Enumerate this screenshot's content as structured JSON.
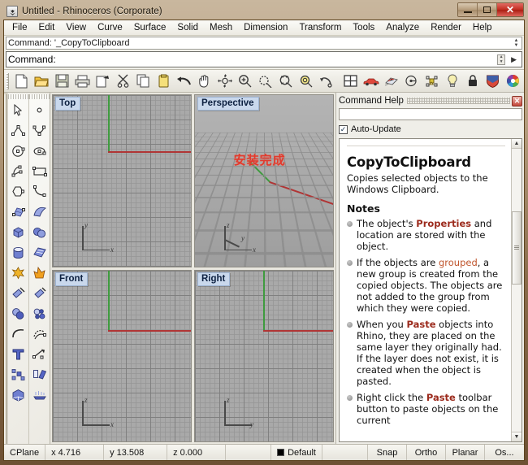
{
  "window": {
    "title": "Untitled - Rhinoceros (Corporate)",
    "app_icon": "rhinoceros-icon",
    "controls": [
      {
        "name": "minimize-button",
        "glyph": "minimize-icon"
      },
      {
        "name": "maximize-button",
        "glyph": "maximize-icon"
      },
      {
        "name": "close-button",
        "glyph": "close-icon",
        "label": "✕"
      }
    ]
  },
  "menubar": {
    "items": [
      {
        "label": "File"
      },
      {
        "label": "Edit"
      },
      {
        "label": "View"
      },
      {
        "label": "Curve"
      },
      {
        "label": "Surface"
      },
      {
        "label": "Solid"
      },
      {
        "label": "Mesh"
      },
      {
        "label": "Dimension"
      },
      {
        "label": "Transform"
      },
      {
        "label": "Tools"
      },
      {
        "label": "Analyze"
      },
      {
        "label": "Render"
      },
      {
        "label": "Help"
      }
    ]
  },
  "command_area": {
    "history_line": "Command: '_CopyToClipboard",
    "prompt_label": "Command:",
    "input_value": "",
    "input_placeholder": ""
  },
  "toolbar": {
    "buttons": [
      {
        "name": "new-file-icon",
        "title": "New"
      },
      {
        "name": "open-file-icon",
        "title": "Open"
      },
      {
        "name": "save-file-icon",
        "title": "Save"
      },
      {
        "name": "print-icon",
        "title": "Print"
      },
      {
        "name": "copy-to-clipboard-icon",
        "title": "Copy to Clipboard"
      },
      {
        "name": "cut-icon",
        "title": "Cut"
      },
      {
        "name": "copy-icon",
        "title": "Copy"
      },
      {
        "name": "paste-icon",
        "title": "Paste"
      },
      {
        "name": "undo-icon",
        "title": "Undo"
      },
      {
        "name": "pan-hand-icon",
        "title": "Pan"
      },
      {
        "name": "rotate-view-icon",
        "title": "Rotate View"
      },
      {
        "name": "zoom-in-icon",
        "title": "Zoom In"
      },
      {
        "name": "zoom-dynamic-icon",
        "title": "Zoom Dynamic"
      },
      {
        "name": "zoom-window-icon",
        "title": "Zoom Window"
      },
      {
        "name": "zoom-extents-icon",
        "title": "Zoom Extents"
      },
      {
        "name": "zoom-previous-icon",
        "title": "Zoom Previous"
      },
      {
        "name": "four-viewport-icon",
        "title": "4 Viewports"
      },
      {
        "name": "render-car-icon",
        "title": "Render"
      },
      {
        "name": "render-preview-icon",
        "title": "Render Preview"
      },
      {
        "name": "shade-icon",
        "title": "Shade"
      },
      {
        "name": "properties-icon",
        "title": "Properties"
      },
      {
        "name": "light-bulb-icon",
        "title": "Lights"
      },
      {
        "name": "lock-icon",
        "title": "Lock"
      },
      {
        "name": "layer-shield-icon",
        "title": "Layers"
      },
      {
        "name": "color-wheel-icon",
        "title": "Color"
      }
    ]
  },
  "left_toolbar": {
    "column_a": [
      {
        "name": "select-arrow-icon"
      },
      {
        "name": "polyline-icon"
      },
      {
        "name": "circle-icon"
      },
      {
        "name": "arc-icon"
      },
      {
        "name": "polygon-icon"
      },
      {
        "name": "surface-from-points-icon"
      },
      {
        "name": "box-icon"
      },
      {
        "name": "cylinder-icon"
      },
      {
        "name": "explode-star-icon"
      },
      {
        "name": "trim-icon"
      },
      {
        "name": "boolean-union-icon"
      },
      {
        "name": "fillet-curve-icon"
      },
      {
        "name": "text-tool-icon"
      },
      {
        "name": "array-icon"
      },
      {
        "name": "extrude-solid-icon"
      }
    ],
    "column_b": [
      {
        "name": "point-icon"
      },
      {
        "name": "control-point-curve-icon"
      },
      {
        "name": "ellipse-icon"
      },
      {
        "name": "rectangle-icon"
      },
      {
        "name": "curve-interpolate-icon"
      },
      {
        "name": "surface-sweep-icon"
      },
      {
        "name": "sphere-icon"
      },
      {
        "name": "surface-plane-icon"
      },
      {
        "name": "explode-flame-icon"
      },
      {
        "name": "split-icon"
      },
      {
        "name": "boolean-difference-icon"
      },
      {
        "name": "offset-curve-icon"
      },
      {
        "name": "dimension-icon"
      },
      {
        "name": "move-icon"
      },
      {
        "name": "sweep-rail-icon"
      }
    ]
  },
  "viewports": [
    {
      "name": "viewport-top",
      "label": "Top",
      "axes": [
        "y",
        "x"
      ]
    },
    {
      "name": "viewport-perspective",
      "label": "Perspective",
      "axes": [
        "z",
        "y",
        "x"
      ],
      "overlay_text": "安装完成"
    },
    {
      "name": "viewport-front",
      "label": "Front",
      "axes": [
        "z",
        "x"
      ]
    },
    {
      "name": "viewport-right",
      "label": "Right",
      "axes": [
        "z",
        "y"
      ]
    }
  ],
  "help_panel": {
    "title": "Command Help",
    "close_label": "✕",
    "search_value": "",
    "auto_update_label": "Auto-Update",
    "auto_update_checked": true,
    "check_glyph": "✓",
    "heading": "CopyToClipboard",
    "description": "Copies selected objects to the Windows Clipboard.",
    "notes_heading": "Notes",
    "notes": [
      {
        "parts": [
          {
            "t": "The object's "
          },
          {
            "t": "Properties",
            "style": "strong"
          },
          {
            "t": " and location are stored with the object."
          }
        ]
      },
      {
        "parts": [
          {
            "t": "If the objects are "
          },
          {
            "t": "grouped",
            "style": "link"
          },
          {
            "t": ", a new group is created from the copied objects. The objects are not added to the group from which they were copied."
          }
        ]
      },
      {
        "parts": [
          {
            "t": "When you "
          },
          {
            "t": "Paste",
            "style": "strong"
          },
          {
            "t": " objects into Rhino, they are placed on the same layer they originally had. If the layer does not exist, it is created when the object is pasted."
          }
        ]
      },
      {
        "parts": [
          {
            "t": "Right click the "
          },
          {
            "t": "Paste",
            "style": "strong"
          },
          {
            "t": " toolbar button to paste objects on the current"
          }
        ]
      }
    ],
    "scroll_up": "▲",
    "scroll_down": "▼"
  },
  "statusbar": {
    "cplane_label": "CPlane",
    "x_value": "x 4.716",
    "y_value": "y 13.508",
    "z_value": "z 0.000",
    "layer_name": "Default",
    "layer_color": "#000000",
    "toggles": [
      {
        "label": "Snap"
      },
      {
        "label": "Ortho"
      },
      {
        "label": "Planar"
      },
      {
        "label": "Os..."
      }
    ]
  },
  "colors": {
    "axis_red": "#b03535",
    "axis_green": "#3f9b3f",
    "viewport_bg": "#a9a9a9",
    "accent_red": "#9c2b1d",
    "overlay_text": "#e03b2e"
  }
}
